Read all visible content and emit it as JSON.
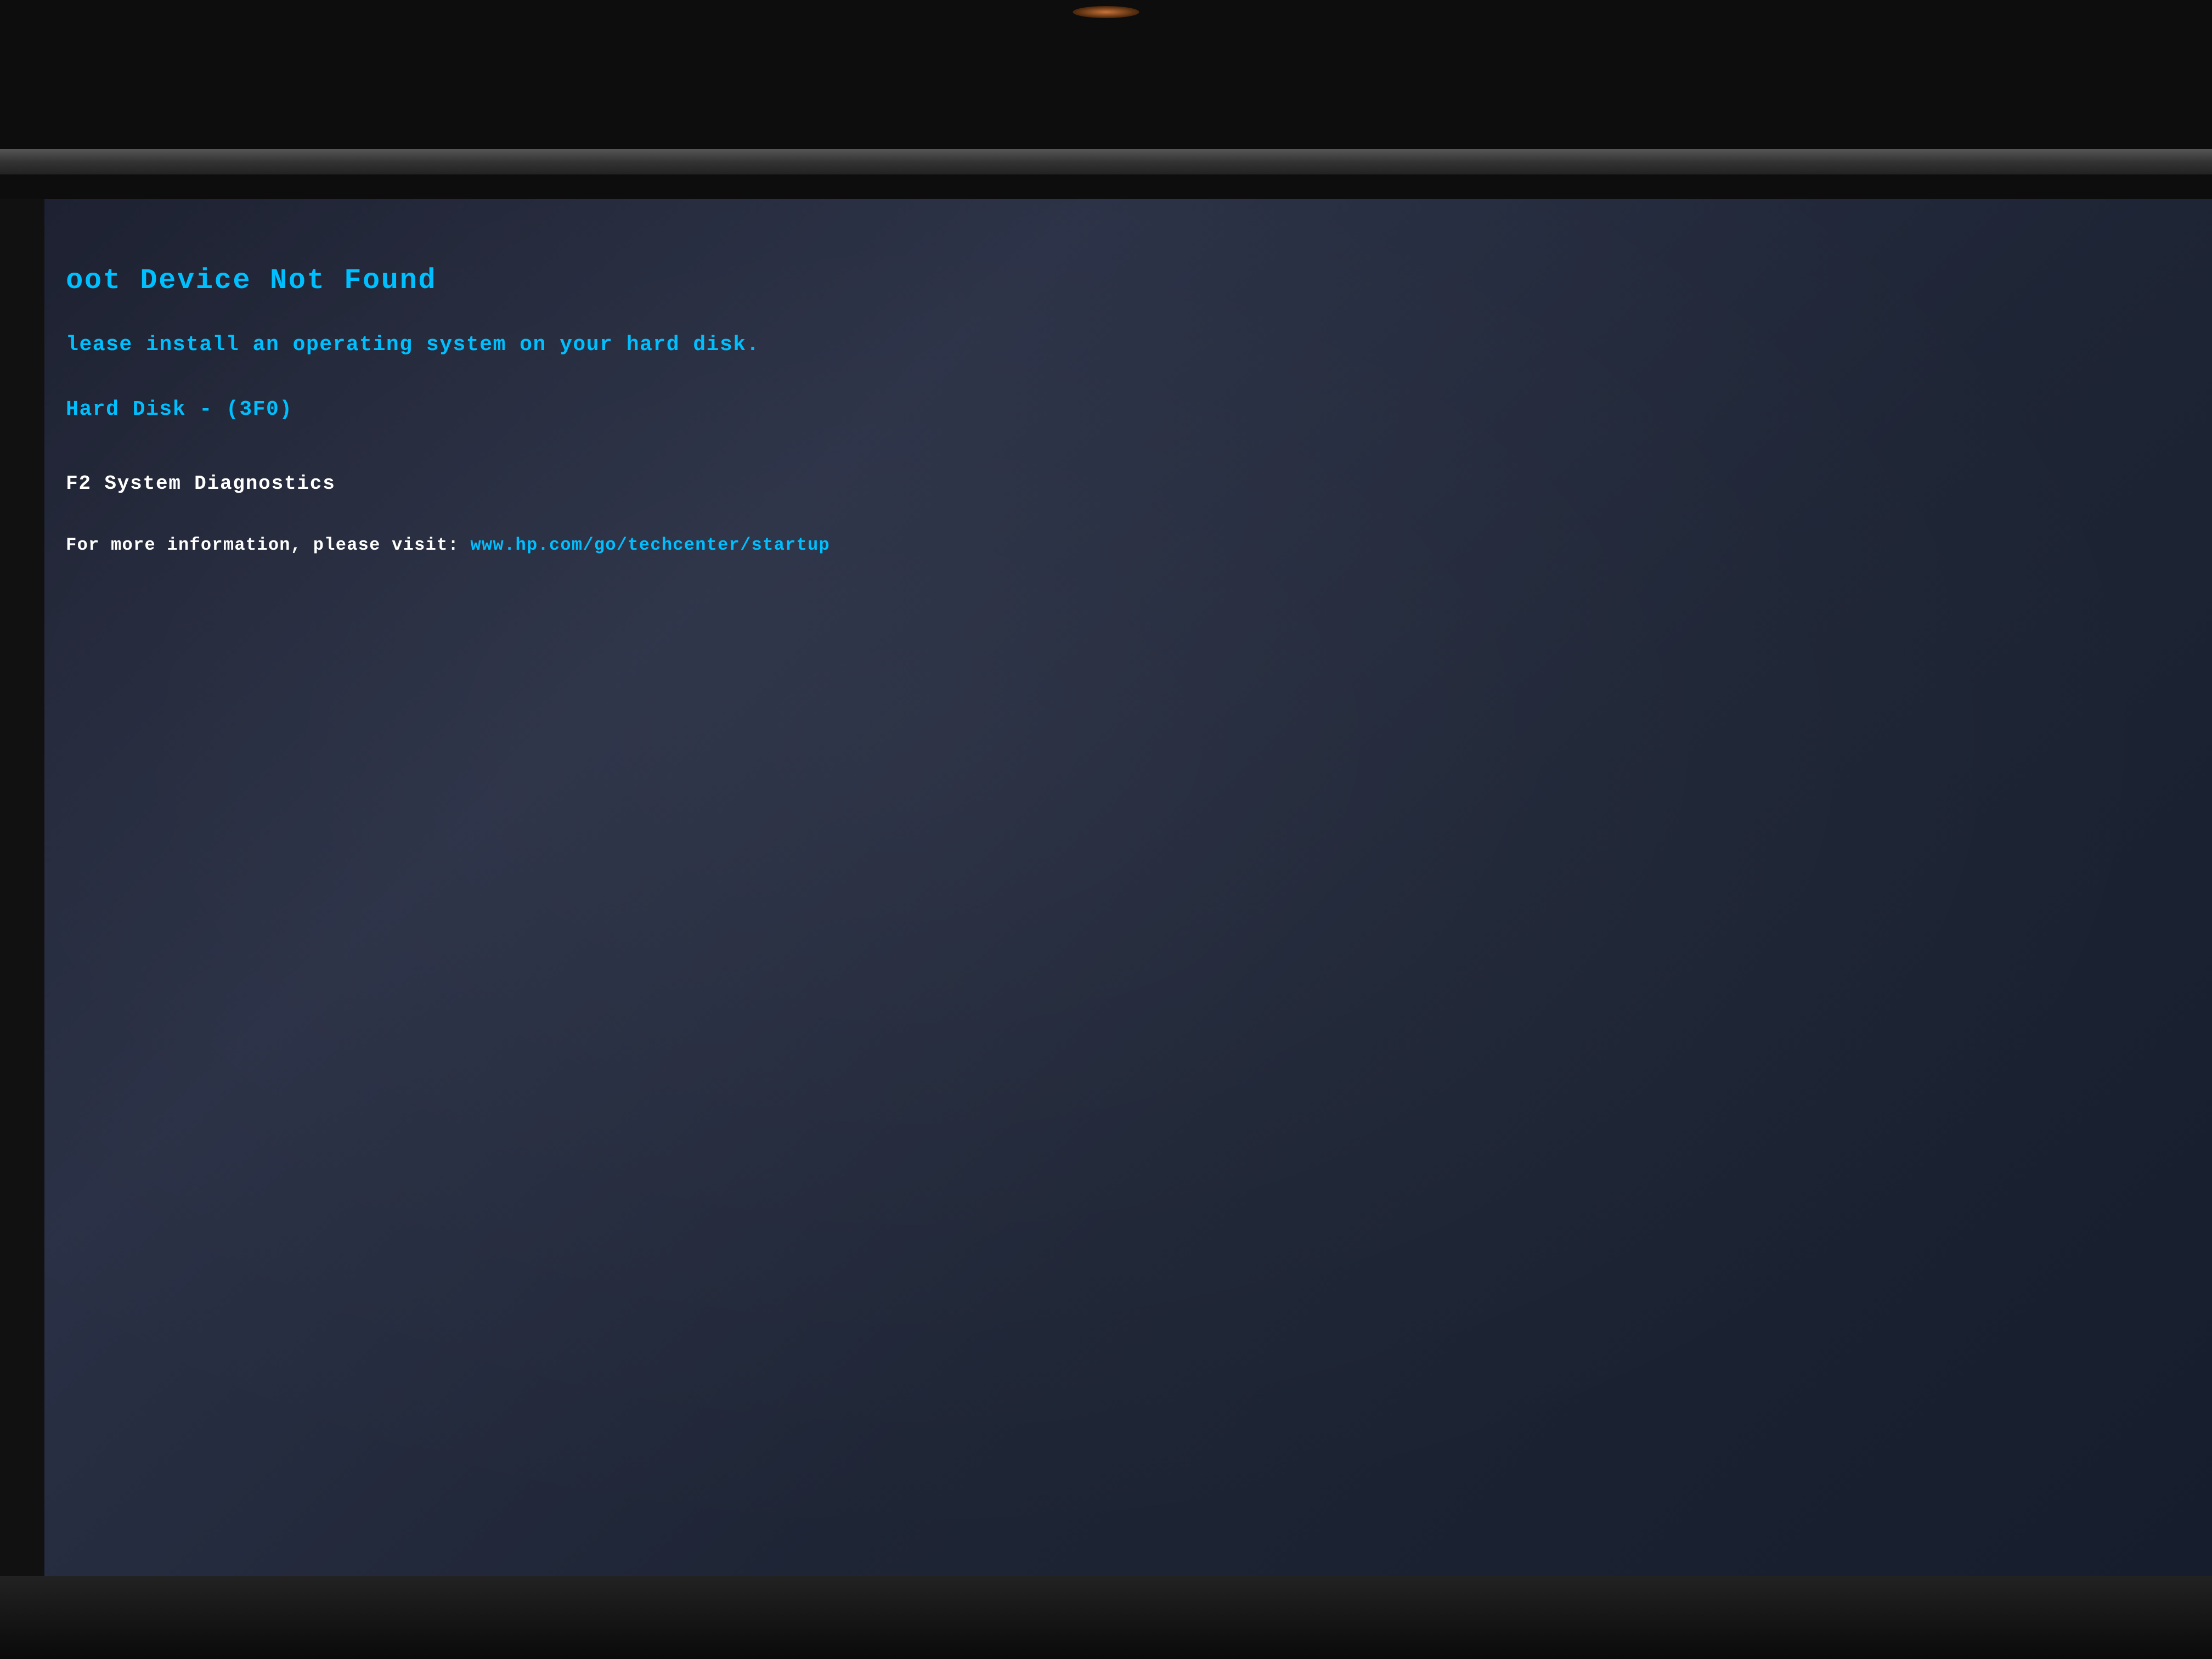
{
  "screen": {
    "background_color": "#1c2030",
    "lines": {
      "title": "oot Device Not Found",
      "subtitle": "lease install an operating system on your hard disk.",
      "error_code": "Hard Disk - (3F0)",
      "key_action": "F2      System Diagnostics",
      "info_label": "For more information, please visit:",
      "info_url": "www.hp.com/go/techcenter/startup"
    },
    "colors": {
      "cyan_text": "#00bfff",
      "white_text": "#ffffff",
      "background": "#1c2535"
    }
  },
  "frame": {
    "top_bezel_color": "#0d0d0d",
    "bottom_bezel_color": "#111"
  }
}
